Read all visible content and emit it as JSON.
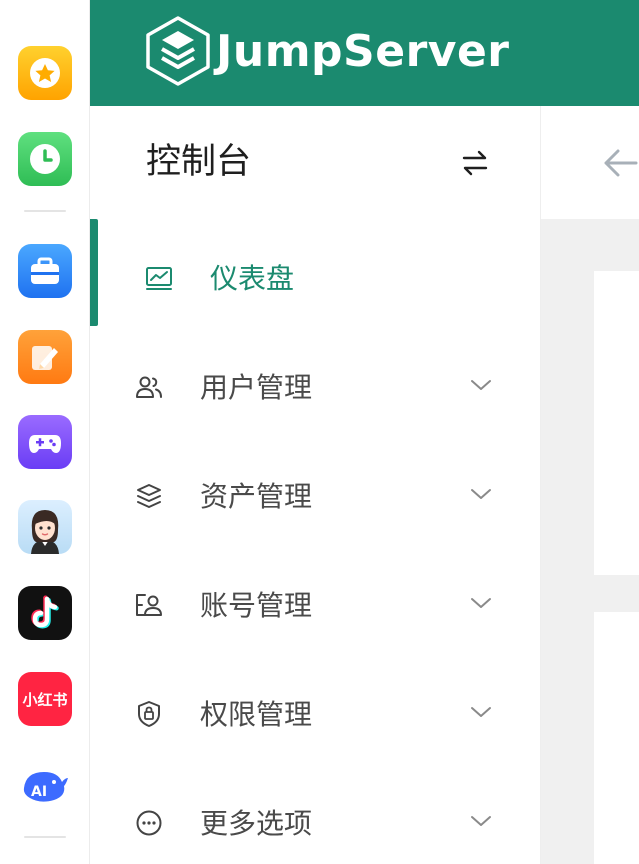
{
  "brand": {
    "name": "JumpServer",
    "color": "#1b8a6f"
  },
  "sidebar": {
    "title": "控制台",
    "items": [
      {
        "label": "仪表盘",
        "icon": "dashboard-chart-icon",
        "active": true,
        "expandable": false
      },
      {
        "label": "用户管理",
        "icon": "users-icon",
        "active": false,
        "expandable": true
      },
      {
        "label": "资产管理",
        "icon": "layers-icon",
        "active": false,
        "expandable": true
      },
      {
        "label": "账号管理",
        "icon": "account-card-icon",
        "active": false,
        "expandable": true
      },
      {
        "label": "权限管理",
        "icon": "shield-lock-icon",
        "active": false,
        "expandable": true
      },
      {
        "label": "更多选项",
        "icon": "more-circle-icon",
        "active": false,
        "expandable": true
      }
    ]
  },
  "dock": {
    "apps": [
      {
        "name": "favorites-app-icon",
        "color": "#ffb300"
      },
      {
        "name": "clock-app-icon",
        "color": "#34c759"
      },
      {
        "name": "briefcase-app-icon",
        "color": "#2f8cff"
      },
      {
        "name": "notes-app-icon",
        "color": "#ff8a1f"
      },
      {
        "name": "game-controller-app-icon",
        "color": "#7b4dff"
      },
      {
        "name": "avatar-app-icon",
        "color": "#cfe6f7"
      },
      {
        "name": "tiktok-app-icon",
        "color": "#111111"
      },
      {
        "name": "xiaohongshu-app",
        "label": "小红书",
        "color": "#ff2442"
      },
      {
        "name": "ai-whale-app-icon",
        "label": "AI",
        "color": "#3d6bff"
      }
    ]
  }
}
